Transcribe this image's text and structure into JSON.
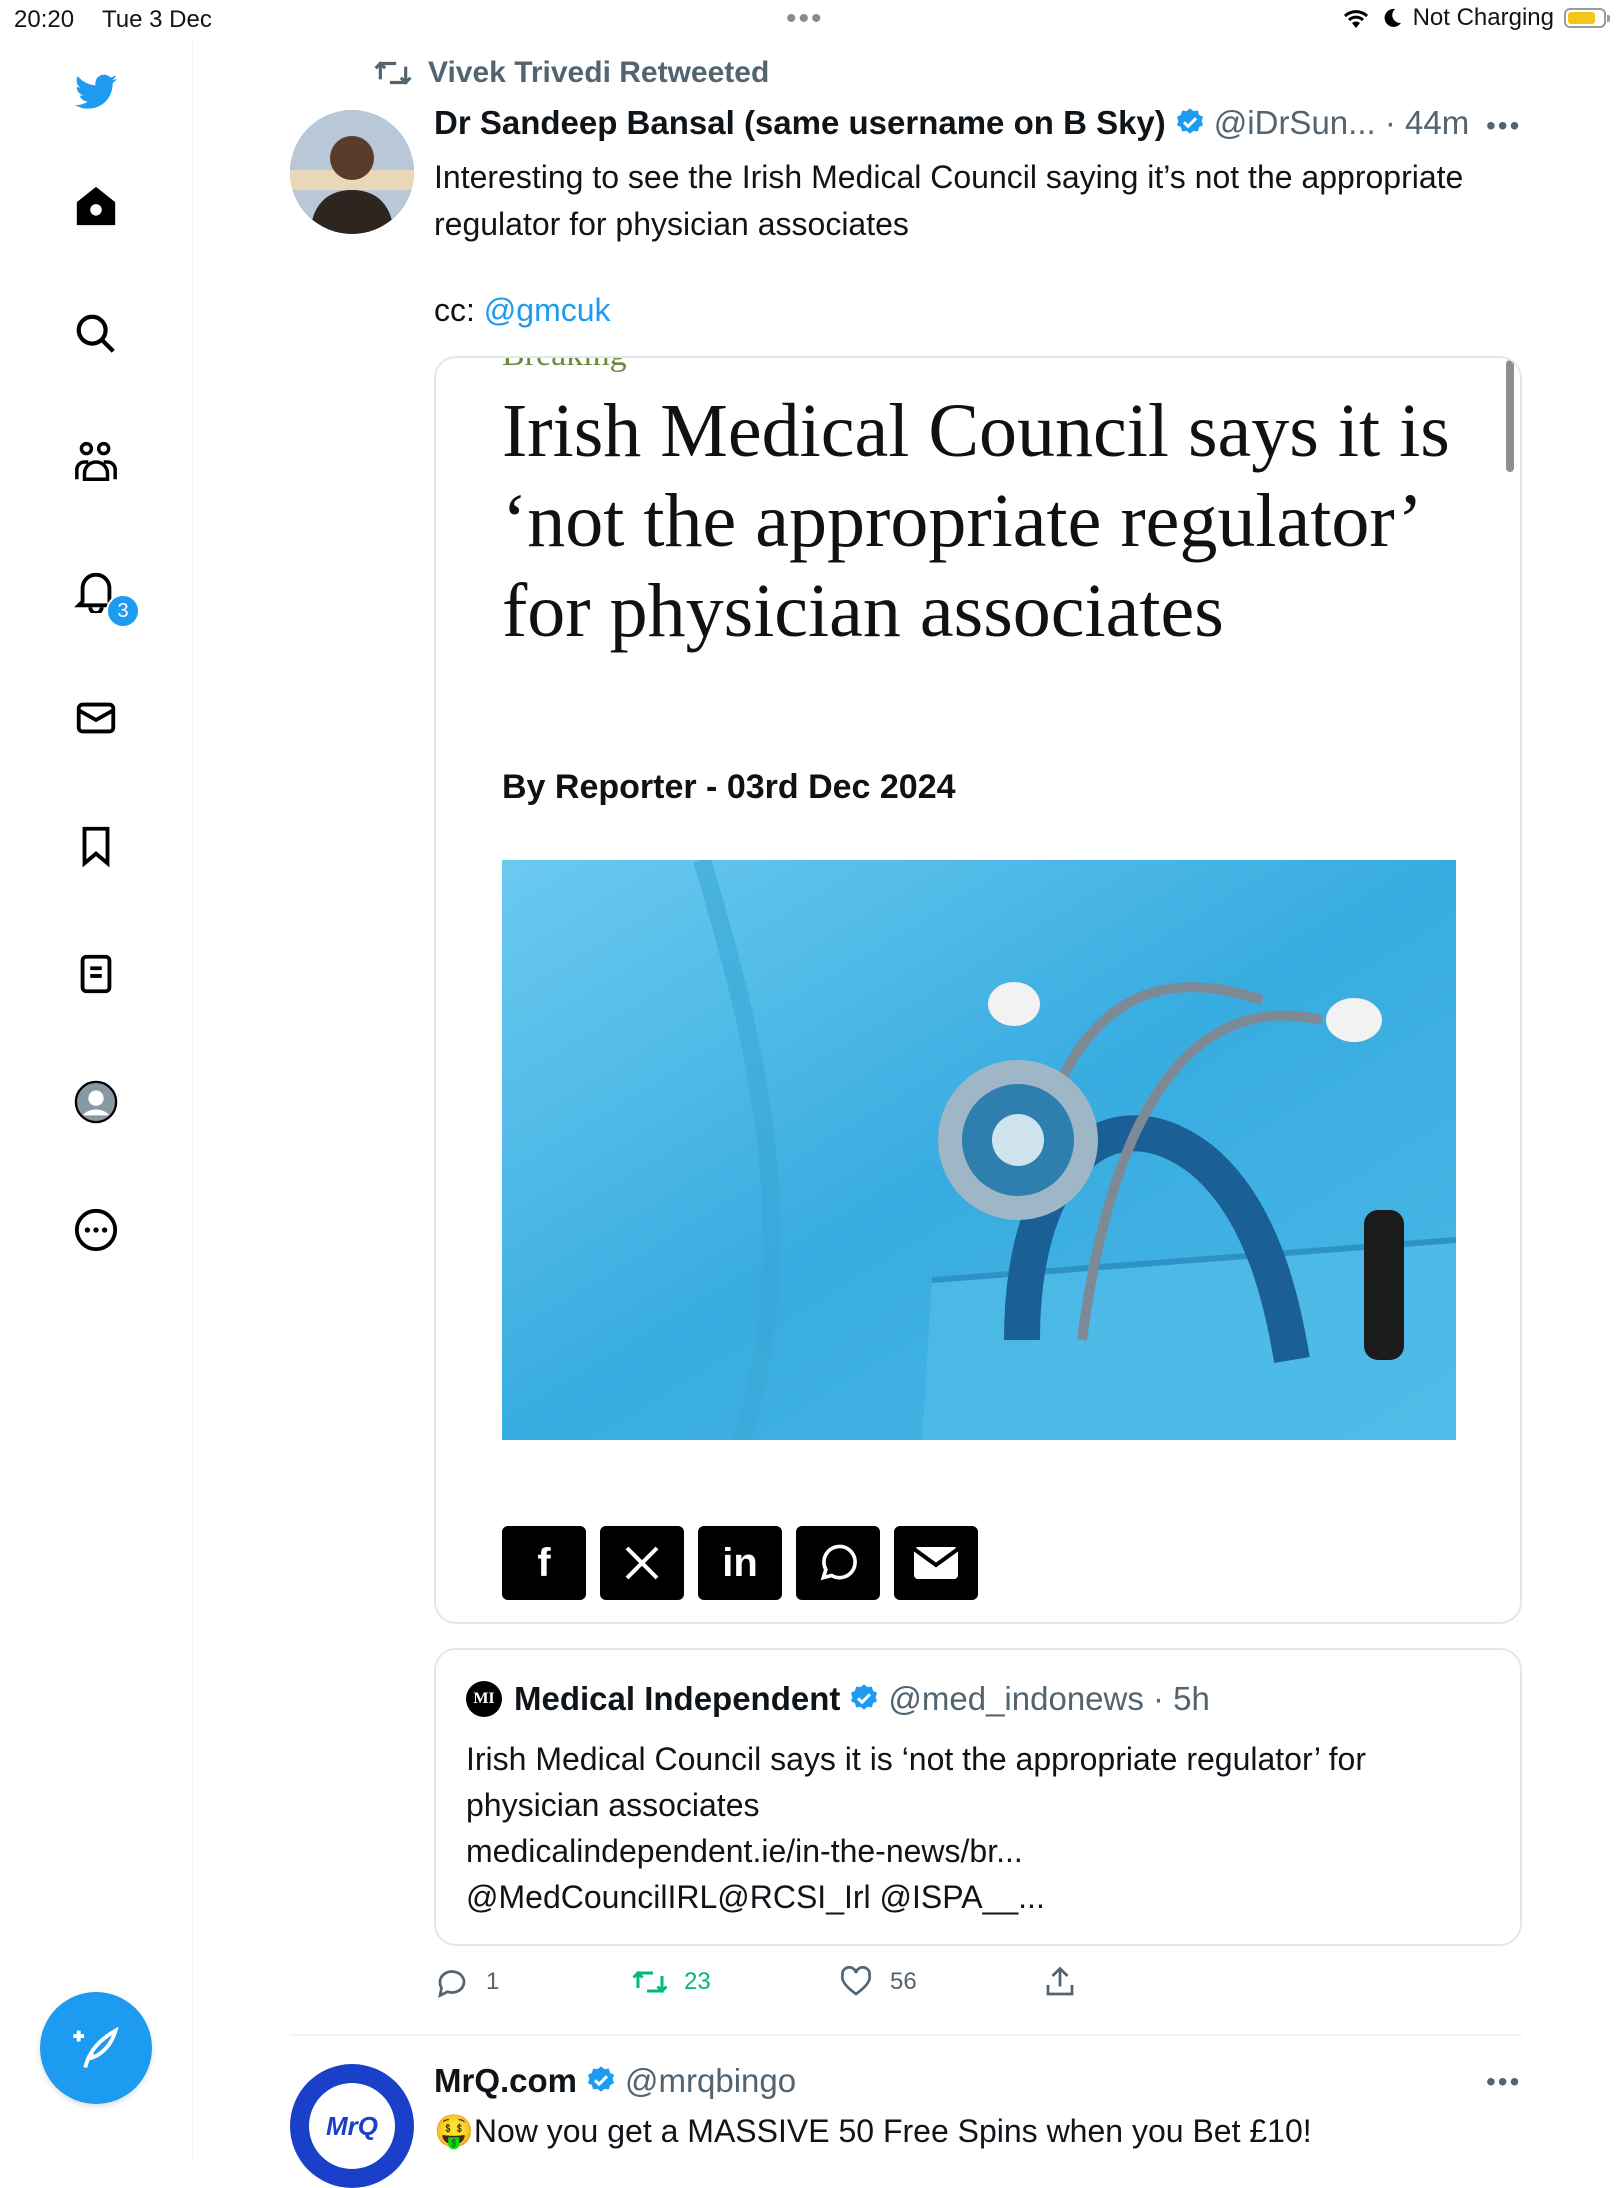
{
  "status_bar": {
    "time": "20:20",
    "date": "Tue 3 Dec",
    "charging": "Not Charging",
    "battery_level": 0.7
  },
  "sidebar": {
    "items": [
      {
        "icon": "home-icon"
      },
      {
        "icon": "search-icon"
      },
      {
        "icon": "communities-icon"
      },
      {
        "icon": "bell-icon",
        "badge": "3"
      },
      {
        "icon": "envelope-icon"
      },
      {
        "icon": "bookmark-icon"
      },
      {
        "icon": "lists-icon"
      },
      {
        "icon": "profile-icon"
      },
      {
        "icon": "more-circle-icon"
      }
    ]
  },
  "tweet": {
    "retweeted_by": "Vivek Trivedi Retweeted",
    "author_name": "Dr Sandeep Bansal (same username on B Sky)",
    "handle_time": "@iDrSun... · 44m",
    "text": "Interesting to see the Irish Medical Council saying it’s not the appropriate regulator for physician associates",
    "cc_prefix": "cc: ",
    "cc_link": "@gmcuk",
    "card": {
      "section": "Breaking",
      "headline": "Irish Medical Council says it is ‘not the appropriate regulator’ for physician associates",
      "byline": "By Reporter - 03rd Dec 2024",
      "share_buttons": [
        "f",
        "X",
        "in",
        "whatsapp",
        "mail"
      ]
    },
    "quoted": {
      "logo": "MI",
      "name": "Medical Independent",
      "handle_time": "@med_indonews · 5h",
      "line1": "Irish Medical Council says it is ‘not the appropriate regulator’ for",
      "line2": "physician associates",
      "line3": "medicalindependent.ie/in-the-news/br...",
      "line4": "@MedCouncilIRL@RCSI_Irl @ISPA__..."
    },
    "actions": {
      "replies": "1",
      "retweets": "23",
      "likes": "56"
    }
  },
  "next_tweet": {
    "avatar_text": "MrQ",
    "name": "MrQ.com",
    "handle": "@mrqbingo",
    "text": "🤑Now you get a MASSIVE 50 Free Spins when you Bet £10!"
  },
  "colors": {
    "accent": "#1d9bf0",
    "text_secondary": "#536471",
    "retweet_green": "#00ba7c"
  }
}
